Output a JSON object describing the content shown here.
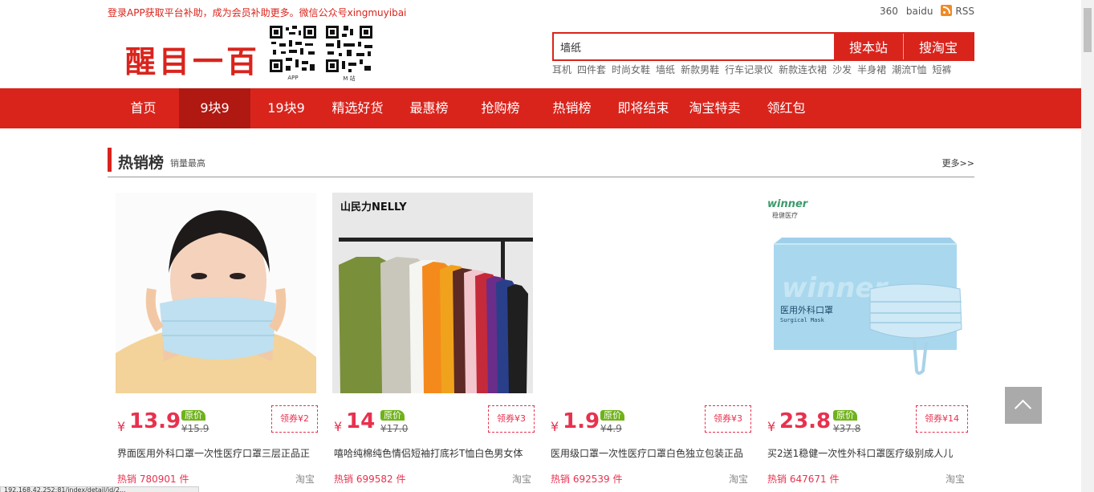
{
  "topbar": {
    "notice": "登录APP获取平台补助，成为会员补助更多。微信公众号xingmuyibai",
    "links": [
      "360",
      "baidu",
      "RSS"
    ]
  },
  "header": {
    "logo_text": "醒目一百",
    "qr_app_label": "APP",
    "qr_m_label": "M 站",
    "search_value": "墙纸",
    "search_site_label": "搜本站",
    "search_taobao_label": "搜淘宝",
    "hot_words": [
      "耳机",
      "四件套",
      "时尚女鞋",
      "墙纸",
      "新款男鞋",
      "行车记录仪",
      "新款连衣裙",
      "沙发",
      "半身裙",
      "潮流T恤",
      "短裤"
    ]
  },
  "nav": {
    "items": [
      "首页",
      "9块9",
      "19块9",
      "精选好货",
      "最惠榜",
      "抢购榜",
      "热销榜",
      "即将结束",
      "淘宝特卖",
      "领红包"
    ],
    "active_index": 1
  },
  "section": {
    "title": "热销榜",
    "subtitle": "销量最高",
    "more": "更多>>"
  },
  "products": [
    {
      "price": "13.9",
      "orig_tag": "原价",
      "orig_price": "¥15.9",
      "coupon": "领券¥2",
      "title": "界面医用外科口罩一次性医疗口罩三层正品正",
      "sales": "热销 780901 件",
      "source": "淘宝",
      "yen": "¥"
    },
    {
      "price": "14",
      "orig_tag": "原价",
      "orig_price": "¥17.0",
      "coupon": "领券¥3",
      "title": "嘻哈纯棉纯色情侣短袖打底衫T恤白色男女体",
      "sales": "热销 699582 件",
      "source": "淘宝",
      "yen": "¥"
    },
    {
      "price": "1.9",
      "orig_tag": "原价",
      "orig_price": "¥4.9",
      "coupon": "领券¥3",
      "title": "医用级口罩一次性医疗口罩白色独立包装正品",
      "sales": "热销 692539 件",
      "source": "淘宝",
      "yen": "¥"
    },
    {
      "price": "23.8",
      "orig_tag": "原价",
      "orig_price": "¥37.8",
      "coupon": "领券¥14",
      "title": "买2送1稳健一次性外科口罩医疗级别成人儿",
      "sales": "热销 647671 件",
      "source": "淘宝",
      "yen": "¥"
    }
  ],
  "product_images": {
    "brand_tshirt": "山民力NELLY",
    "brand_winner": "winner",
    "brand_winner_cn": "稳健医疗",
    "box_title": "医用外科口罩",
    "box_sub": "Surgical Mask"
  },
  "colors": {
    "brand_red": "#d9241c",
    "nav_active": "#b01812",
    "price_red": "#e8314e",
    "orig_green": "#6fb21a"
  },
  "status_url": "192.168.42.252:81/index/detail/id/2..."
}
